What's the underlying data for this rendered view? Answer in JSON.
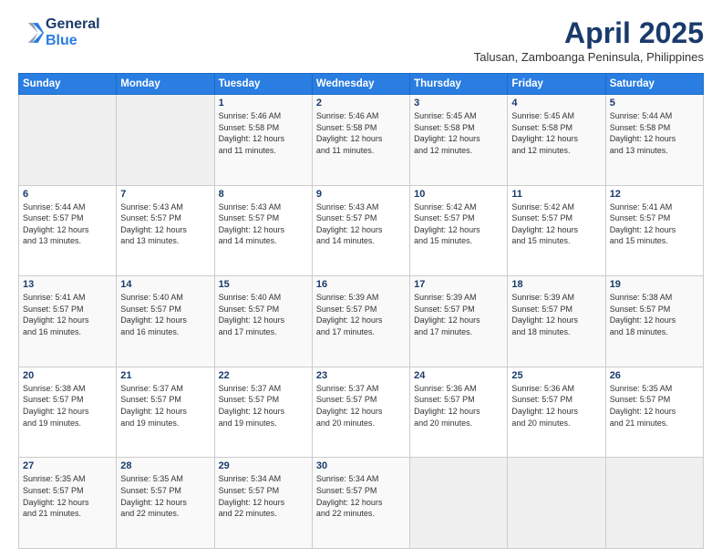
{
  "header": {
    "logo_line1": "General",
    "logo_line2": "Blue",
    "month_year": "April 2025",
    "location": "Talusan, Zamboanga Peninsula, Philippines"
  },
  "calendar": {
    "days_of_week": [
      "Sunday",
      "Monday",
      "Tuesday",
      "Wednesday",
      "Thursday",
      "Friday",
      "Saturday"
    ],
    "weeks": [
      [
        {
          "day": "",
          "details": ""
        },
        {
          "day": "",
          "details": ""
        },
        {
          "day": "1",
          "details": "Sunrise: 5:46 AM\nSunset: 5:58 PM\nDaylight: 12 hours\nand 11 minutes."
        },
        {
          "day": "2",
          "details": "Sunrise: 5:46 AM\nSunset: 5:58 PM\nDaylight: 12 hours\nand 11 minutes."
        },
        {
          "day": "3",
          "details": "Sunrise: 5:45 AM\nSunset: 5:58 PM\nDaylight: 12 hours\nand 12 minutes."
        },
        {
          "day": "4",
          "details": "Sunrise: 5:45 AM\nSunset: 5:58 PM\nDaylight: 12 hours\nand 12 minutes."
        },
        {
          "day": "5",
          "details": "Sunrise: 5:44 AM\nSunset: 5:58 PM\nDaylight: 12 hours\nand 13 minutes."
        }
      ],
      [
        {
          "day": "6",
          "details": "Sunrise: 5:44 AM\nSunset: 5:57 PM\nDaylight: 12 hours\nand 13 minutes."
        },
        {
          "day": "7",
          "details": "Sunrise: 5:43 AM\nSunset: 5:57 PM\nDaylight: 12 hours\nand 13 minutes."
        },
        {
          "day": "8",
          "details": "Sunrise: 5:43 AM\nSunset: 5:57 PM\nDaylight: 12 hours\nand 14 minutes."
        },
        {
          "day": "9",
          "details": "Sunrise: 5:43 AM\nSunset: 5:57 PM\nDaylight: 12 hours\nand 14 minutes."
        },
        {
          "day": "10",
          "details": "Sunrise: 5:42 AM\nSunset: 5:57 PM\nDaylight: 12 hours\nand 15 minutes."
        },
        {
          "day": "11",
          "details": "Sunrise: 5:42 AM\nSunset: 5:57 PM\nDaylight: 12 hours\nand 15 minutes."
        },
        {
          "day": "12",
          "details": "Sunrise: 5:41 AM\nSunset: 5:57 PM\nDaylight: 12 hours\nand 15 minutes."
        }
      ],
      [
        {
          "day": "13",
          "details": "Sunrise: 5:41 AM\nSunset: 5:57 PM\nDaylight: 12 hours\nand 16 minutes."
        },
        {
          "day": "14",
          "details": "Sunrise: 5:40 AM\nSunset: 5:57 PM\nDaylight: 12 hours\nand 16 minutes."
        },
        {
          "day": "15",
          "details": "Sunrise: 5:40 AM\nSunset: 5:57 PM\nDaylight: 12 hours\nand 17 minutes."
        },
        {
          "day": "16",
          "details": "Sunrise: 5:39 AM\nSunset: 5:57 PM\nDaylight: 12 hours\nand 17 minutes."
        },
        {
          "day": "17",
          "details": "Sunrise: 5:39 AM\nSunset: 5:57 PM\nDaylight: 12 hours\nand 17 minutes."
        },
        {
          "day": "18",
          "details": "Sunrise: 5:39 AM\nSunset: 5:57 PM\nDaylight: 12 hours\nand 18 minutes."
        },
        {
          "day": "19",
          "details": "Sunrise: 5:38 AM\nSunset: 5:57 PM\nDaylight: 12 hours\nand 18 minutes."
        }
      ],
      [
        {
          "day": "20",
          "details": "Sunrise: 5:38 AM\nSunset: 5:57 PM\nDaylight: 12 hours\nand 19 minutes."
        },
        {
          "day": "21",
          "details": "Sunrise: 5:37 AM\nSunset: 5:57 PM\nDaylight: 12 hours\nand 19 minutes."
        },
        {
          "day": "22",
          "details": "Sunrise: 5:37 AM\nSunset: 5:57 PM\nDaylight: 12 hours\nand 19 minutes."
        },
        {
          "day": "23",
          "details": "Sunrise: 5:37 AM\nSunset: 5:57 PM\nDaylight: 12 hours\nand 20 minutes."
        },
        {
          "day": "24",
          "details": "Sunrise: 5:36 AM\nSunset: 5:57 PM\nDaylight: 12 hours\nand 20 minutes."
        },
        {
          "day": "25",
          "details": "Sunrise: 5:36 AM\nSunset: 5:57 PM\nDaylight: 12 hours\nand 20 minutes."
        },
        {
          "day": "26",
          "details": "Sunrise: 5:35 AM\nSunset: 5:57 PM\nDaylight: 12 hours\nand 21 minutes."
        }
      ],
      [
        {
          "day": "27",
          "details": "Sunrise: 5:35 AM\nSunset: 5:57 PM\nDaylight: 12 hours\nand 21 minutes."
        },
        {
          "day": "28",
          "details": "Sunrise: 5:35 AM\nSunset: 5:57 PM\nDaylight: 12 hours\nand 22 minutes."
        },
        {
          "day": "29",
          "details": "Sunrise: 5:34 AM\nSunset: 5:57 PM\nDaylight: 12 hours\nand 22 minutes."
        },
        {
          "day": "30",
          "details": "Sunrise: 5:34 AM\nSunset: 5:57 PM\nDaylight: 12 hours\nand 22 minutes."
        },
        {
          "day": "",
          "details": ""
        },
        {
          "day": "",
          "details": ""
        },
        {
          "day": "",
          "details": ""
        }
      ]
    ]
  }
}
